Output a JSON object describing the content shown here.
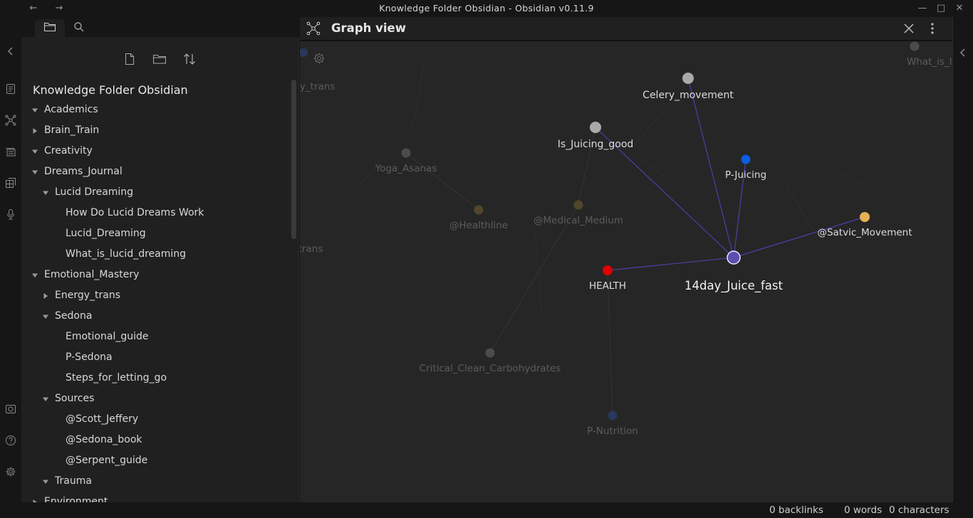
{
  "window": {
    "title": "Knowledge Folder Obsidian - Obsidian v0.11.9"
  },
  "sidebar": {
    "vault_name": "Knowledge Folder Obsidian",
    "tree": [
      {
        "label": "Academics",
        "level": 0,
        "state": "expanded"
      },
      {
        "label": "Brain_Train",
        "level": 0,
        "state": "collapsed"
      },
      {
        "label": "Creativity",
        "level": 0,
        "state": "expanded"
      },
      {
        "label": "Dreams_Journal",
        "level": 0,
        "state": "expanded"
      },
      {
        "label": "Lucid Dreaming",
        "level": 1,
        "state": "expanded"
      },
      {
        "label": "How Do Lucid Dreams Work",
        "level": 2,
        "state": "file"
      },
      {
        "label": "Lucid_Dreaming",
        "level": 2,
        "state": "file"
      },
      {
        "label": "What_is_lucid_dreaming",
        "level": 2,
        "state": "file"
      },
      {
        "label": "Emotional_Mastery",
        "level": 0,
        "state": "expanded"
      },
      {
        "label": "Energy_trans",
        "level": 1,
        "state": "collapsed"
      },
      {
        "label": "Sedona",
        "level": 1,
        "state": "expanded"
      },
      {
        "label": "Emotional_guide",
        "level": 2,
        "state": "file"
      },
      {
        "label": "P-Sedona",
        "level": 2,
        "state": "file"
      },
      {
        "label": "Steps_for_letting_go",
        "level": 2,
        "state": "file"
      },
      {
        "label": "Sources",
        "level": 1,
        "state": "expanded"
      },
      {
        "label": "@Scott_Jeffery",
        "level": 2,
        "state": "file"
      },
      {
        "label": "@Sedona_book",
        "level": 2,
        "state": "file"
      },
      {
        "label": "@Serpent_guide",
        "level": 2,
        "state": "file"
      },
      {
        "label": "Trauma",
        "level": 1,
        "state": "expanded"
      },
      {
        "label": "Environment",
        "level": 0,
        "state": "collapsed"
      }
    ]
  },
  "graph": {
    "title": "Graph view",
    "nodes": [
      {
        "id": "juice",
        "label": "14day_Juice_fast",
        "color": "#5b4fb0",
        "focus": true
      },
      {
        "id": "celery",
        "label": "Celery_movement",
        "color": "#a9a9a9"
      },
      {
        "id": "isjuicing",
        "label": "Is_Juicing_good",
        "color": "#a9a9a9"
      },
      {
        "id": "pjuicing",
        "label": "P-Juicing",
        "color": "#0a5ee0"
      },
      {
        "id": "satvic",
        "label": "@Satvic_Movement",
        "color": "#e6b155"
      },
      {
        "id": "health",
        "label": "HEALTH",
        "color": "#e00000"
      },
      {
        "id": "yoga",
        "label": "Yoga_Asanas",
        "color": "#555555",
        "faded": true
      },
      {
        "id": "healthline",
        "label": "@Healthline",
        "color": "#5c4e30",
        "faded": true
      },
      {
        "id": "medical",
        "label": "@Medical_Medium",
        "color": "#5c4e30",
        "faded": true
      },
      {
        "id": "critical",
        "label": "Critical_Clean_Carbohydrates",
        "color": "#555555",
        "faded": true
      },
      {
        "id": "pnutrition",
        "label": "P-Nutrition",
        "color": "#2a3d6a",
        "faded": true
      },
      {
        "id": "lucid",
        "label": "What_is_lucid_dream",
        "color": "#555555",
        "faded": true
      },
      {
        "id": "energy",
        "label": "Energy_trans",
        "color": "#2a3d6a",
        "faded": true
      },
      {
        "id": "trans",
        "label": "trans",
        "color": "#555555",
        "faded": true
      }
    ],
    "edges": [
      [
        "juice",
        "celery"
      ],
      [
        "juice",
        "isjuicing"
      ],
      [
        "juice",
        "pjuicing"
      ],
      [
        "juice",
        "satvic"
      ],
      [
        "juice",
        "health"
      ]
    ],
    "faint_edges": [
      [
        "health",
        "pnutrition"
      ],
      [
        "yoga",
        "healthline"
      ],
      [
        "isjuicing",
        "medical"
      ],
      [
        "medical",
        "critical"
      ]
    ]
  },
  "status": {
    "backlinks": "0 backlinks",
    "words": "0 words",
    "characters": "0 characters"
  }
}
